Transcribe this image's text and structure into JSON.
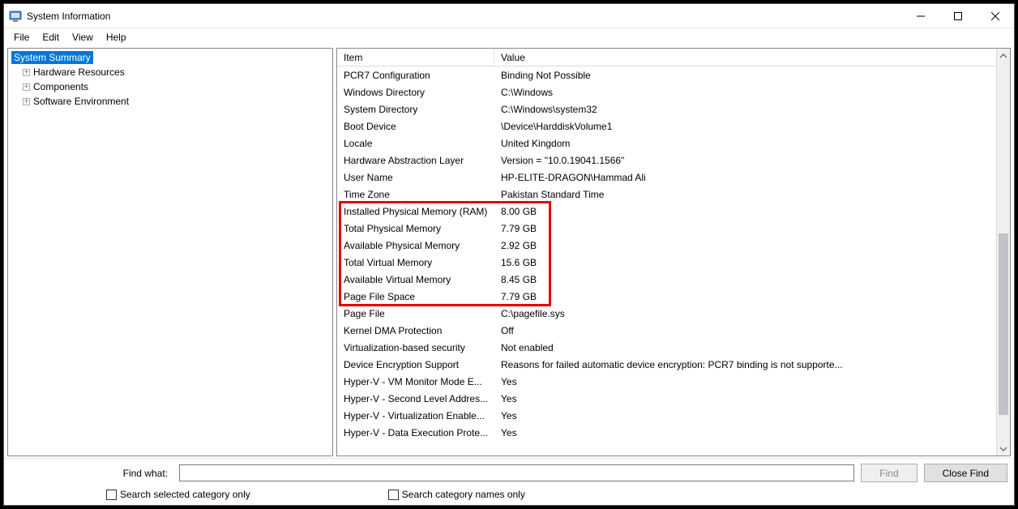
{
  "window": {
    "title": "System Information"
  },
  "menu": {
    "file": "File",
    "edit": "Edit",
    "view": "View",
    "help": "Help"
  },
  "tree": {
    "root": "System Summary",
    "items": [
      "Hardware Resources",
      "Components",
      "Software Environment"
    ]
  },
  "list": {
    "header_item": "Item",
    "header_value": "Value",
    "rows": [
      {
        "item": "PCR7 Configuration",
        "value": "Binding Not Possible"
      },
      {
        "item": "Windows Directory",
        "value": "C:\\Windows"
      },
      {
        "item": "System Directory",
        "value": "C:\\Windows\\system32"
      },
      {
        "item": "Boot Device",
        "value": "\\Device\\HarddiskVolume1"
      },
      {
        "item": "Locale",
        "value": "United Kingdom"
      },
      {
        "item": "Hardware Abstraction Layer",
        "value": "Version = \"10.0.19041.1566\""
      },
      {
        "item": "User Name",
        "value": "HP-ELITE-DRAGON\\Hammad Ali"
      },
      {
        "item": "Time Zone",
        "value": "Pakistan Standard Time"
      },
      {
        "item": "Installed Physical Memory (RAM)",
        "value": "8.00 GB"
      },
      {
        "item": "Total Physical Memory",
        "value": "7.79 GB"
      },
      {
        "item": "Available Physical Memory",
        "value": "2.92 GB"
      },
      {
        "item": "Total Virtual Memory",
        "value": "15.6 GB"
      },
      {
        "item": "Available Virtual Memory",
        "value": "8.45 GB"
      },
      {
        "item": "Page File Space",
        "value": "7.79 GB"
      },
      {
        "item": "Page File",
        "value": "C:\\pagefile.sys"
      },
      {
        "item": "Kernel DMA Protection",
        "value": "Off"
      },
      {
        "item": "Virtualization-based security",
        "value": "Not enabled"
      },
      {
        "item": "Device Encryption Support",
        "value": "Reasons for failed automatic device encryption: PCR7 binding is not supporte..."
      },
      {
        "item": "Hyper-V - VM Monitor Mode E...",
        "value": "Yes"
      },
      {
        "item": "Hyper-V - Second Level Addres...",
        "value": "Yes"
      },
      {
        "item": "Hyper-V - Virtualization Enable...",
        "value": "Yes"
      },
      {
        "item": "Hyper-V - Data Execution Prote...",
        "value": "Yes"
      }
    ]
  },
  "search": {
    "label": "Find what:",
    "input_value": "",
    "find_btn": "Find",
    "close_btn": "Close Find",
    "chk_selected": "Search selected category only",
    "chk_names": "Search category names only"
  }
}
